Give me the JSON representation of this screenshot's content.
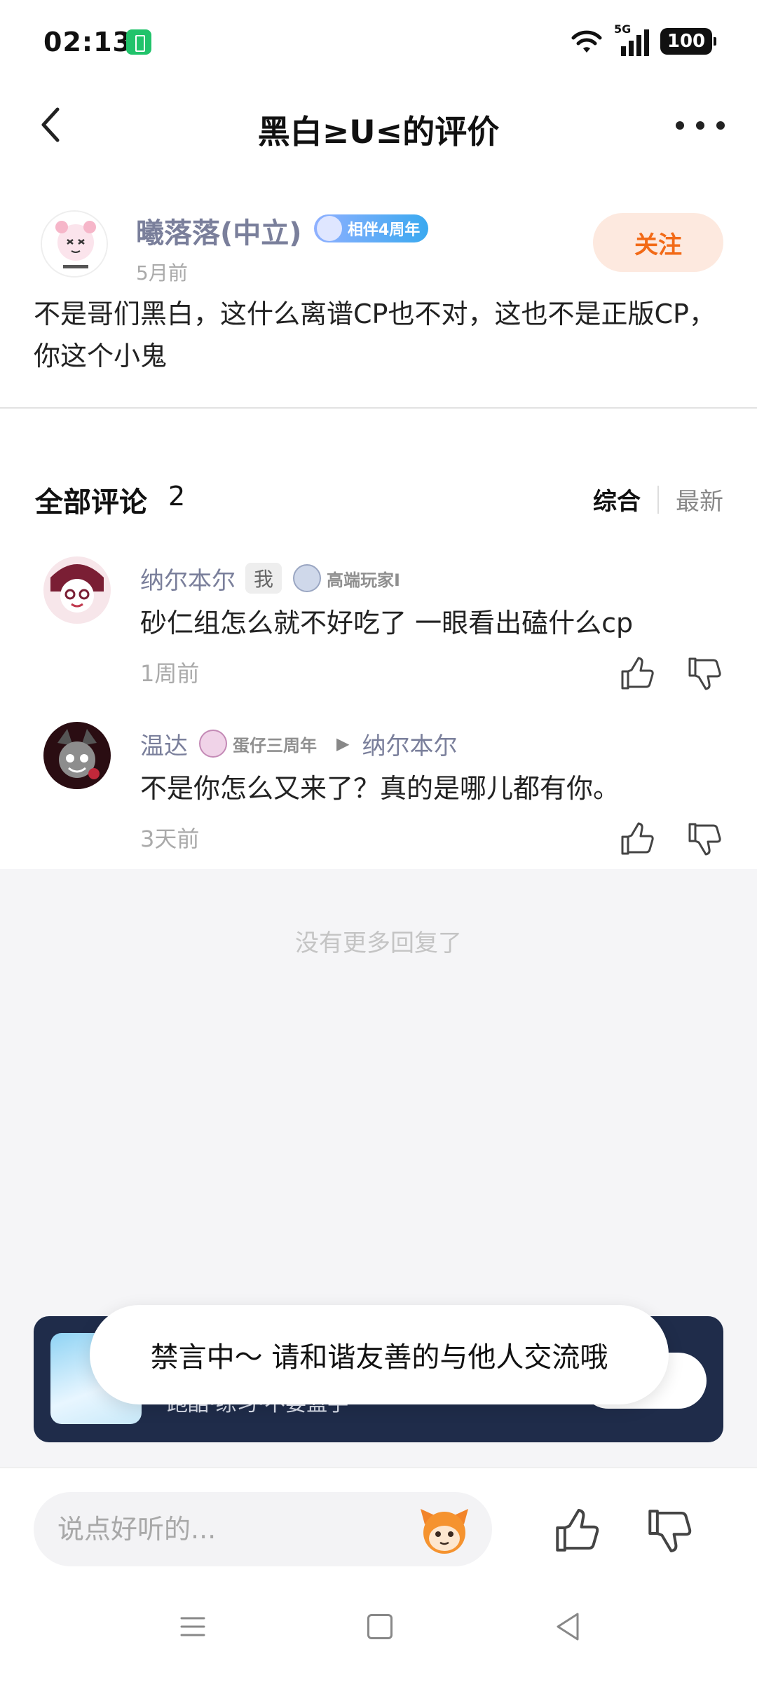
{
  "status_bar": {
    "time": "02:13",
    "network": "5G",
    "battery": "100"
  },
  "nav": {
    "title": "黑白≥ᑌ≤的评价"
  },
  "review": {
    "author": "曦落落(中立)",
    "badge": "相伴4周年",
    "time": "5月前",
    "follow_label": "关注",
    "text": "不是哥们黑白，这什么离谱CP也不对，这也不是正版CP，你这个小鬼"
  },
  "comments_header": {
    "title": "全部评论",
    "count": "2",
    "sort_tabs": [
      "综合",
      "最新"
    ],
    "active_sort": "综合"
  },
  "comments": [
    {
      "author": "纳尔本尔",
      "me_tag": "我",
      "level": "高端玩家I",
      "text": "砂仁组怎么就不好吃了 一眼看出磕什么cp",
      "time": "1周前"
    },
    {
      "author": "温达",
      "level": "蛋仔三周年",
      "reply_arrow": "▶",
      "reply_to": "纳尔本尔",
      "text": "不是你怎么又来了？真的是哪儿都有你。",
      "time": "3天前"
    }
  ],
  "no_more": "没有更多回复了",
  "toast": "禁言中～ 请和谐友善的与他人交流哦",
  "game_card": {
    "tagline": "跑酷·练习·不要蓝手"
  },
  "input": {
    "placeholder": "说点好听的..."
  },
  "colors": {
    "accent": "#f26a17",
    "name": "#7a7f9b",
    "card_bg": "#1f2c4a"
  }
}
